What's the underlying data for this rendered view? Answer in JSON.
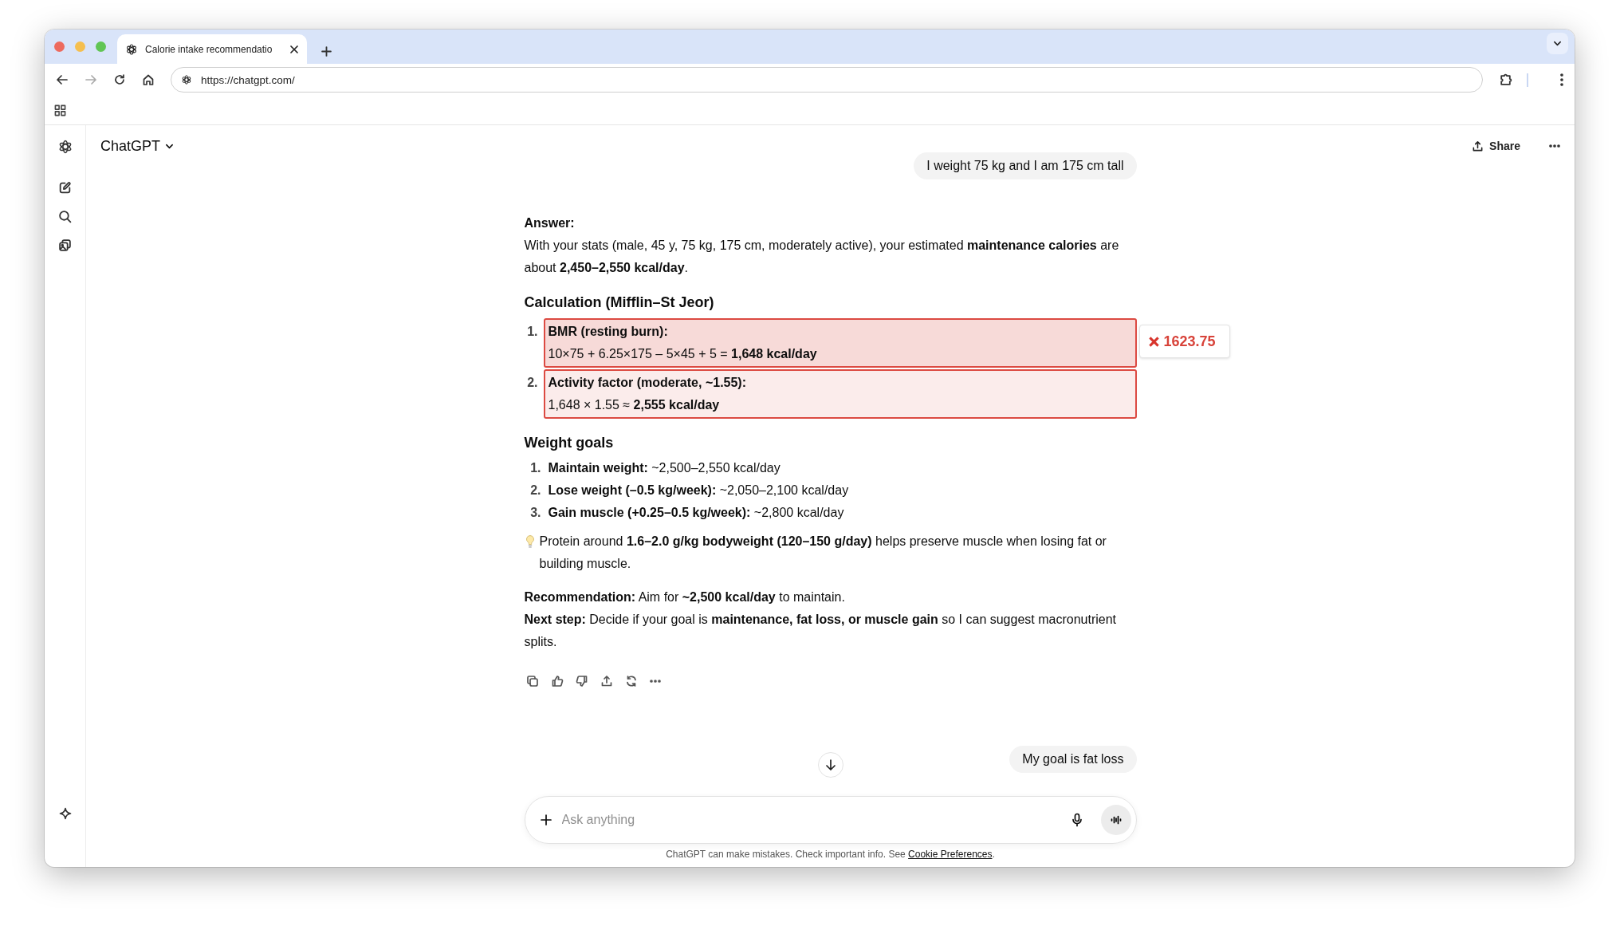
{
  "browser": {
    "tabs": [
      {
        "title": "Calorie intake recommendatio",
        "selected": true
      }
    ],
    "address": "https://chatgpt.com/"
  },
  "header": {
    "title": "ChatGPT",
    "share": "Share"
  },
  "messages": [
    {
      "kind": "user_message",
      "text": "I weight 75 kg and I am 175 cm tall"
    },
    {
      "kind": "assistant_message",
      "blocks": [
        {
          "kind": "label",
          "text": "Answer:"
        },
        {
          "kind": "paragraph",
          "texts": [
            "With your stats (male, 45 y, 75 kg, 175 cm, moderately active), your estimated **maintenance calories** are about **2,450–2,550 kcal/day**."
          ]
        },
        {
          "kind": "heading",
          "text": "Calculation (Mifflin–St Jeor)"
        },
        {
          "kind": "steps",
          "items": [
            {
              "number": "1.",
              "title": "BMR (resting burn):",
              "text": "10×75 + 6.25×175 – 5×45 + 5 = **1,648 kcal/day**",
              "color": "#f7dad8",
              "annotation": "1623.75"
            },
            {
              "number": "2.",
              "title": "Activity factor (moderate, ~1.55):",
              "text": "1,648 × 1.55 ≈ **2,555 kcal/day**",
              "color": "#fbeceb"
            }
          ]
        },
        {
          "kind": "heading",
          "text": "Weight goals"
        },
        {
          "kind": "list",
          "items": [
            {
              "number": "1.",
              "text": "**Maintain weight:** ~2,500–2,550 kcal/day"
            },
            {
              "number": "2.",
              "text": "**Lose weight (–0.5 kg/week):** ~2,050–2,100 kcal/day"
            },
            {
              "number": "3.",
              "text": "**Gain muscle (+0.25–0.5 kg/week):** ~2,800 kcal/day"
            }
          ]
        },
        {
          "kind": "tip",
          "text": "Protein around **1.6–2.0 g/kg bodyweight (120–150 g/day)** helps preserve muscle when losing fat or building muscle."
        },
        {
          "kind": "paragraph",
          "texts": [
            "**Recommendation:** Aim for **~2,500 kcal/day** to maintain.",
            "**Next step:** Decide if your goal is **maintenance, fat loss, or muscle gain** so I can suggest macronutrient splits."
          ]
        }
      ]
    },
    {
      "kind": "user_message",
      "text": "My goal is fat loss"
    }
  ],
  "composer": {
    "placeholder": "Ask anything"
  },
  "disclaimer": {
    "text": "ChatGPT can make mistakes. Check important info. See ",
    "link": "Cookie Preferences",
    "after": "."
  }
}
